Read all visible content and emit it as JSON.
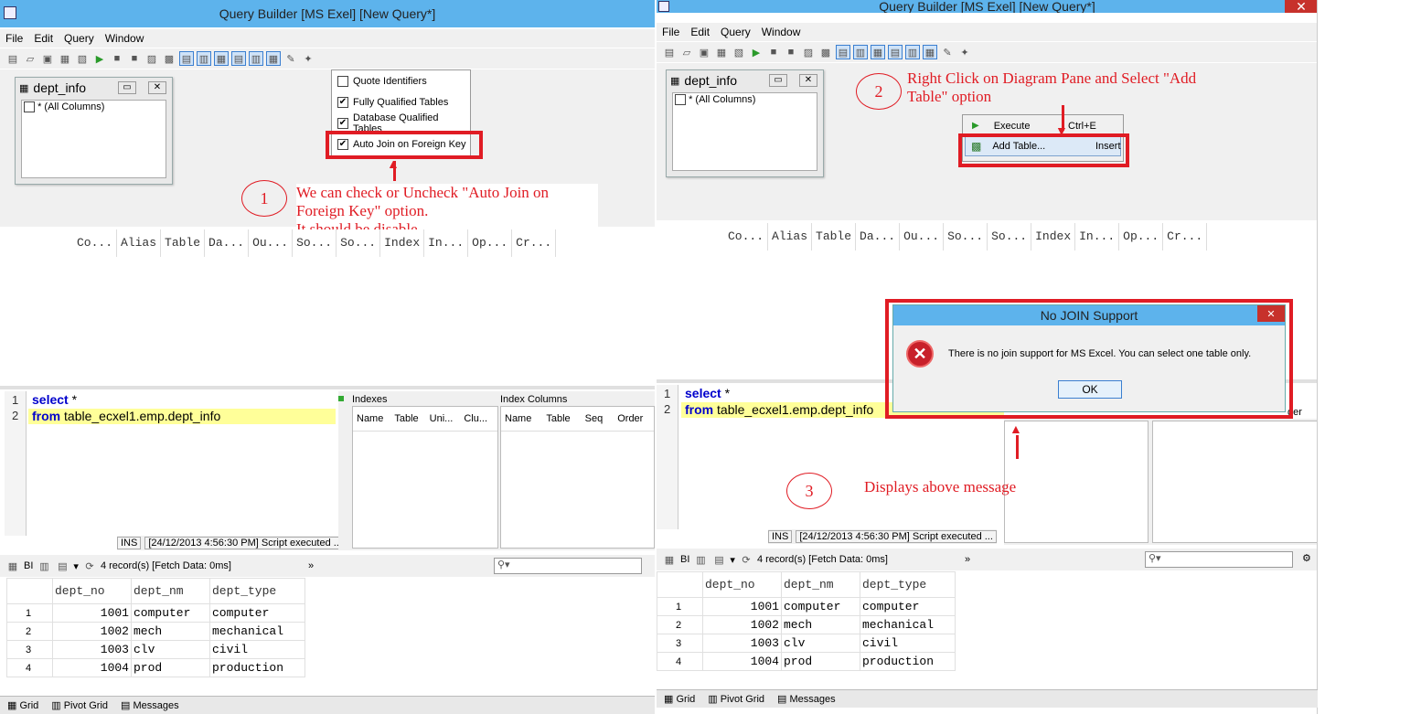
{
  "window_title": "Query Builder [MS Exel] [New Query*]",
  "menu": [
    "File",
    "Edit",
    "Query",
    "Window"
  ],
  "table_box": {
    "title": "dept_info",
    "all_columns": "* (All Columns)"
  },
  "options_dropdown": {
    "items": [
      {
        "label": "Quote Identifiers",
        "checked": false
      },
      {
        "label": "Fully Qualified Tables",
        "checked": true
      },
      {
        "label": "Database Qualified Tables",
        "checked": true
      },
      {
        "label": "Auto Join on Foreign Key",
        "checked": true
      }
    ]
  },
  "criteria_columns": [
    "Co...",
    "Alias",
    "Table",
    "Da...",
    "Ou...",
    "So...",
    "So...",
    "Index",
    "In...",
    "Op...",
    "Cr..."
  ],
  "sql": {
    "line1_num": "1",
    "line1_kw": "select",
    "line1_rest": " *",
    "line2_num": "2",
    "line2_kw": "from",
    "line2_rest": " table_ecxel1.emp.dept_info"
  },
  "indexes_panel": {
    "title": "Indexes",
    "columns": [
      "Name",
      "Table",
      "Uni...",
      "Clu..."
    ],
    "index_columns_title": "Index Columns",
    "index_columns": [
      "Name",
      "Table",
      "Seq",
      "Order"
    ]
  },
  "status": {
    "mode": "INS",
    "message": "[24/12/2013 4:56:30 PM] Script executed ..."
  },
  "results": {
    "bi_label": "BI",
    "record_info": "4 record(s) [Fetch Data: 0ms]",
    "chevrons": "»",
    "columns": [
      "dept_no",
      "dept_nm",
      "dept_type"
    ],
    "rows": [
      {
        "n": "1",
        "no": "1001",
        "nm": "computer",
        "type": "computer"
      },
      {
        "n": "2",
        "no": "1002",
        "nm": "mech",
        "type": "mechanical"
      },
      {
        "n": "3",
        "no": "1003",
        "nm": "clv",
        "type": "civil"
      },
      {
        "n": "4",
        "no": "1004",
        "nm": "prod",
        "type": "production"
      }
    ]
  },
  "bottom_tabs": [
    "Grid",
    "Pivot Grid",
    "Messages"
  ],
  "context_menu": {
    "execute_label": "Execute",
    "execute_shortcut": "Ctrl+E",
    "add_table_label": "Add Table...",
    "add_table_shortcut": "Insert"
  },
  "dialog": {
    "title": "No JOIN Support",
    "message": "There is no join support for MS Excel.  You can select one table only.",
    "ok": "OK",
    "close": "✕"
  },
  "annotations": {
    "step1_num": "1",
    "step1_text": "We can check or Uncheck \"Auto Join on Foreign Key\" option.",
    "step1_text2": "It should be disable.",
    "step2_num": "2",
    "step2_text": "Right Click on Diagram Pane and Select \"Add Table\" option",
    "step3_num": "3",
    "step3_text": "Displays above message"
  },
  "partial_order_label": "der",
  "colors": {
    "titlebar": "#5db3ec",
    "annotation_red": "#e01c24",
    "close_red": "#c7312b"
  }
}
